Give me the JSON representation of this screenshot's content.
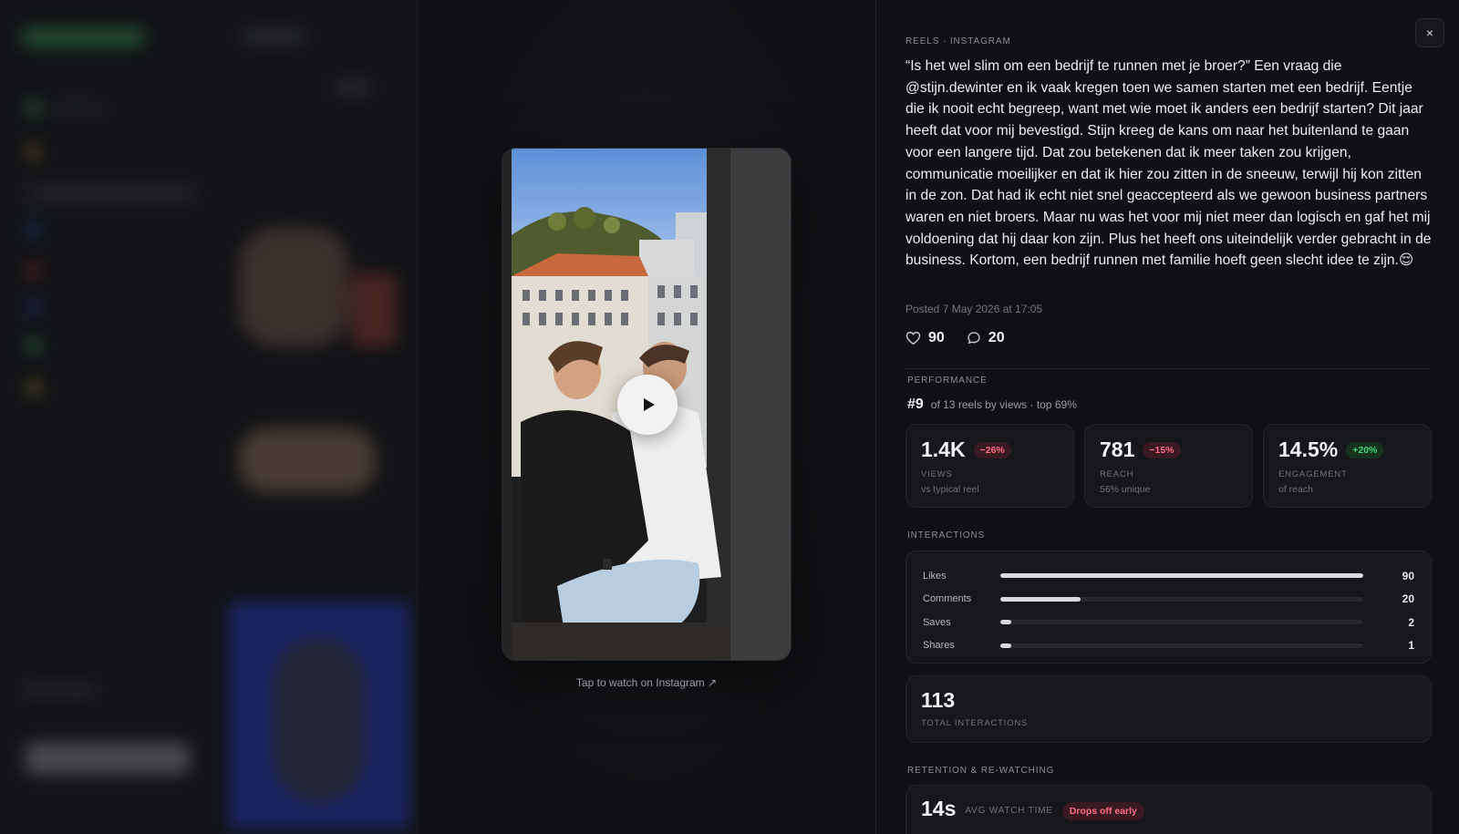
{
  "caption_section": {
    "label": "REELS · INSTAGRAM",
    "text": "“Is het wel slim om een bedrijf te runnen met je broer?” Een vraag die @stijn.dewinter en ik vaak kregen toen we samen starten met een bedrijf. Eentje die ik nooit echt begreep, want met wie moet ik anders een bedrijf starten? Dit jaar heeft dat voor mij bevestigd. Stijn kreeg de kans om naar het buitenland te gaan voor een langere tijd. Dat zou betekenen dat ik meer taken zou krijgen, communicatie moeilijker en dat ik hier zou zitten in de sneeuw, terwijl hij kon zitten in de zon. Dat had ik echt niet snel geaccepteerd als we gewoon business partners waren en niet broers. Maar nu was het voor mij niet meer dan logisch en gaf het mij voldoening dat hij daar kon zijn. Plus het heeft ons uiteindelijk verder gebracht in de business. Kortom, een bedrijf runnen met familie hoeft geen slecht idee te zijn.😌",
    "posted": "Posted 7 May 2026 at 17:05"
  },
  "close": {
    "label": "×"
  },
  "engagement": {
    "likes": "90",
    "comments": "20"
  },
  "video": {
    "tap_link": "Tap to watch on Instagram ↗"
  },
  "performance": {
    "label": "PERFORMANCE",
    "rank": "#9",
    "rank_text": "of 13 reels by views · top 69%",
    "metrics": [
      {
        "value": "1.4K",
        "badge": "−26%",
        "label": "VIEWS",
        "sub": "vs typical reel",
        "trend": "negative"
      },
      {
        "value": "781",
        "badge": "−15%",
        "label": "REACH",
        "sub": "56% unique",
        "trend": "negative"
      },
      {
        "value": "14.5%",
        "badge": "+20%",
        "label": "ENGAGEMENT",
        "sub": "of reach",
        "trend": "positive"
      }
    ]
  },
  "interactions": {
    "label": "INTERACTIONS",
    "rows": [
      {
        "name": "Likes",
        "value": "90",
        "fraction": 1.0
      },
      {
        "name": "Comments",
        "value": "20",
        "fraction": 0.22
      },
      {
        "name": "Saves",
        "value": "2",
        "fraction": 0.03
      },
      {
        "name": "Shares",
        "value": "1",
        "fraction": 0.03
      }
    ],
    "total_value": "113",
    "total_label": "TOTAL INTERACTIONS"
  },
  "retention": {
    "label": "RETENTION & RE-WATCHING",
    "avg_value": "14s",
    "avg_label": "AVG WATCH TIME",
    "badge": "Drops off early"
  },
  "colors": {
    "negative": "#ff6b86",
    "positive": "#41d67a",
    "panel": "#0f1013"
  }
}
